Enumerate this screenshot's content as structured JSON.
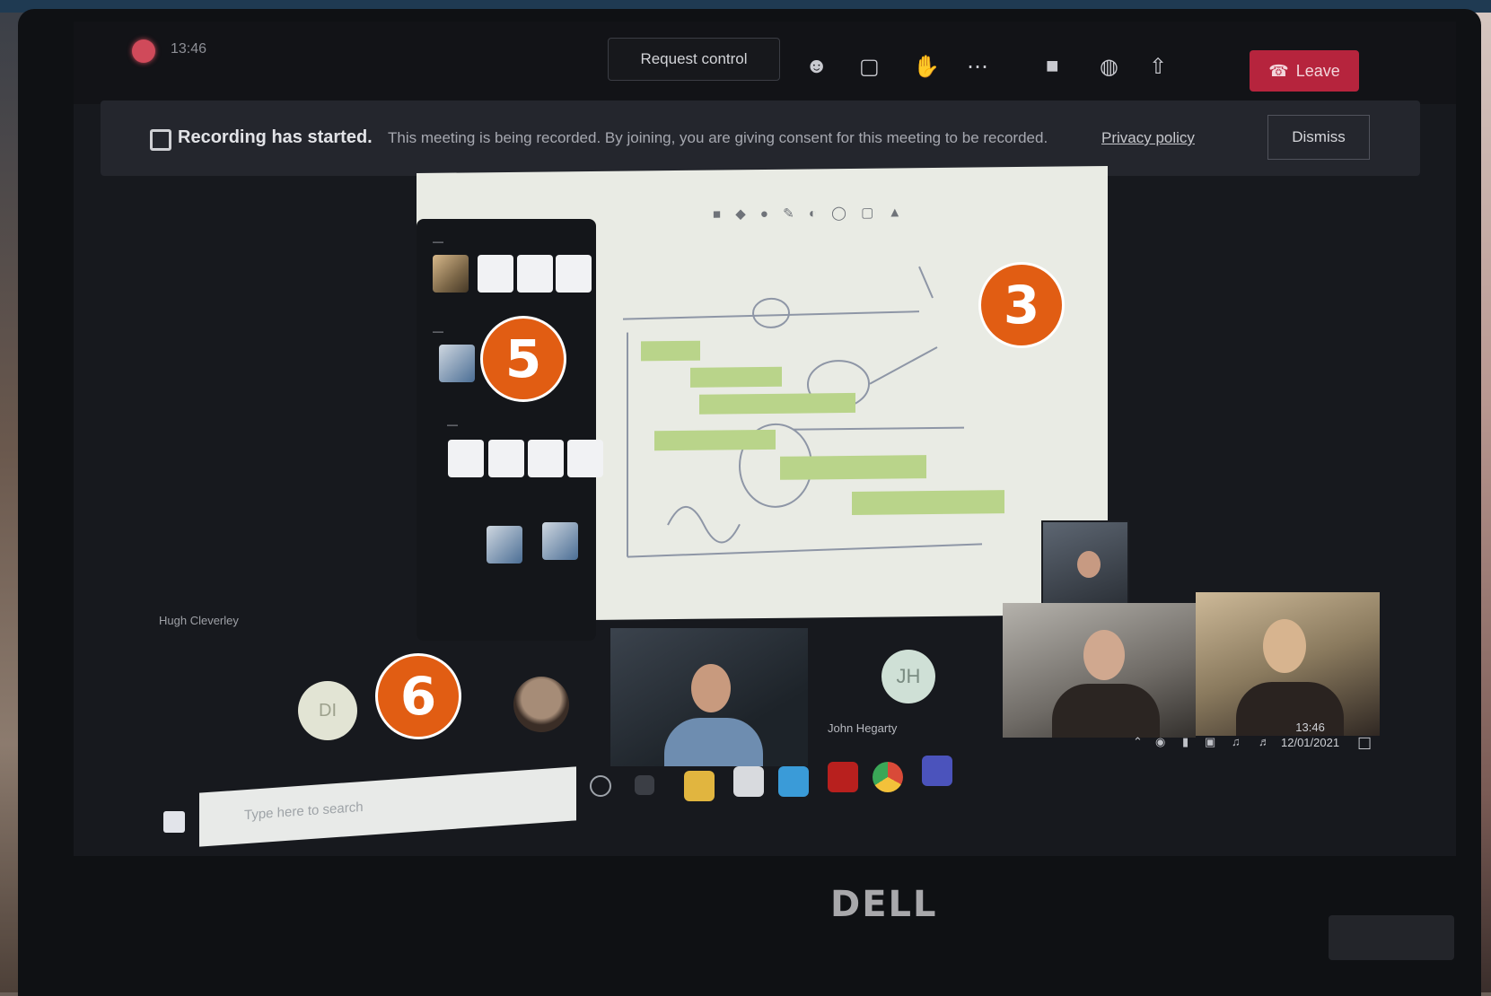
{
  "meeting": {
    "timer": "13:46",
    "request_control_label": "Request control",
    "leave_label": "Leave",
    "toolbar_icons": [
      "people-icon",
      "chat-icon",
      "raise-hand-icon",
      "more-icon",
      "camera-icon",
      "mic-icon",
      "share-icon"
    ]
  },
  "banner": {
    "title": "Recording has started.",
    "text": "This meeting is being recorded. By joining, you are giving consent for this meeting to be recorded.",
    "privacy_link": "Privacy policy",
    "dismiss_label": "Dismiss"
  },
  "whiteboard": {
    "toolbar_glyphs": "■ ◆ ● ✎ ◐ ◯ ▢ ▲"
  },
  "participants": {
    "jh_initials": "JH",
    "jh_name": "John Hegarty",
    "left_initials": "DI",
    "host_label": "Hugh Cleverley"
  },
  "taskbar": {
    "search_placeholder": "Type here to search",
    "time": "13:46",
    "date": "12/01/2021"
  },
  "badges": [
    "3",
    "5",
    "6"
  ],
  "laptop_brand": "DELL",
  "colors": {
    "leave": "#b6243d",
    "badge": "#e15d13",
    "note": "#b9d48a"
  }
}
